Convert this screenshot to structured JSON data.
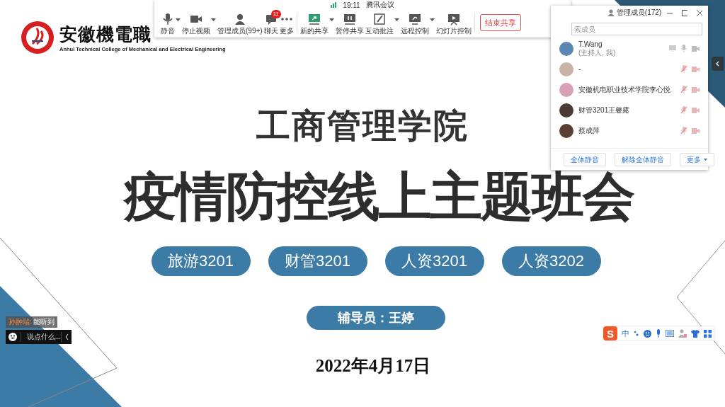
{
  "slide": {
    "logo": {
      "name": "安徽機電職",
      "subtitle": "Anhui Technical College of Mechanical and Electrical Engineering"
    },
    "title": "工商管理学院",
    "heading": "疫情防控线上主题班会",
    "classes": [
      "旅游3201",
      "财管3201",
      "人资3201",
      "人资3202"
    ],
    "counselor": "辅导员：王婷",
    "date": "2022年4月17日"
  },
  "toolbar": {
    "time": "19:11",
    "app": "腾讯会议",
    "items": [
      {
        "label": "静音",
        "has_menu": true
      },
      {
        "label": "停止视频",
        "has_menu": true
      },
      {
        "label": "管理成员(99+)",
        "has_menu": false
      },
      {
        "label": "聊天",
        "has_menu": false,
        "badge": "11"
      },
      {
        "label": "更多",
        "has_menu": false
      },
      {
        "label": "新的共享",
        "has_menu": true
      },
      {
        "label": "暂停共享",
        "has_menu": false
      },
      {
        "label": "互动批注",
        "has_menu": true
      },
      {
        "label": "远程控制",
        "has_menu": true
      },
      {
        "label": "幻灯片控制",
        "has_menu": false
      }
    ],
    "end_button": "结束共享"
  },
  "member_panel": {
    "title": "管理成员(172)",
    "search": {
      "placeholder": "索成员"
    },
    "members": [
      {
        "name": "T.Wang",
        "role": "(主持人, 我)",
        "muted": false,
        "host": true
      },
      {
        "name": "-",
        "muted": true,
        "host": false
      },
      {
        "name": "安徽机电职业技术学院李心悦",
        "muted": true,
        "host": false
      },
      {
        "name": "财管3201王馨露",
        "muted": true,
        "host": false
      },
      {
        "name": "蔡成萍",
        "muted": true,
        "host": false
      }
    ],
    "buttons": [
      {
        "label": "全体静音",
        "has_menu": false
      },
      {
        "label": "解除全体静音",
        "has_menu": false
      },
      {
        "label": "更多",
        "has_menu": true
      }
    ]
  },
  "chat": {
    "sender": "孙翀瑞:",
    "message": "能听到",
    "input": {
      "placeholder": "说点什么..."
    }
  },
  "ime": {
    "logo": "S",
    "mode": "中"
  }
}
